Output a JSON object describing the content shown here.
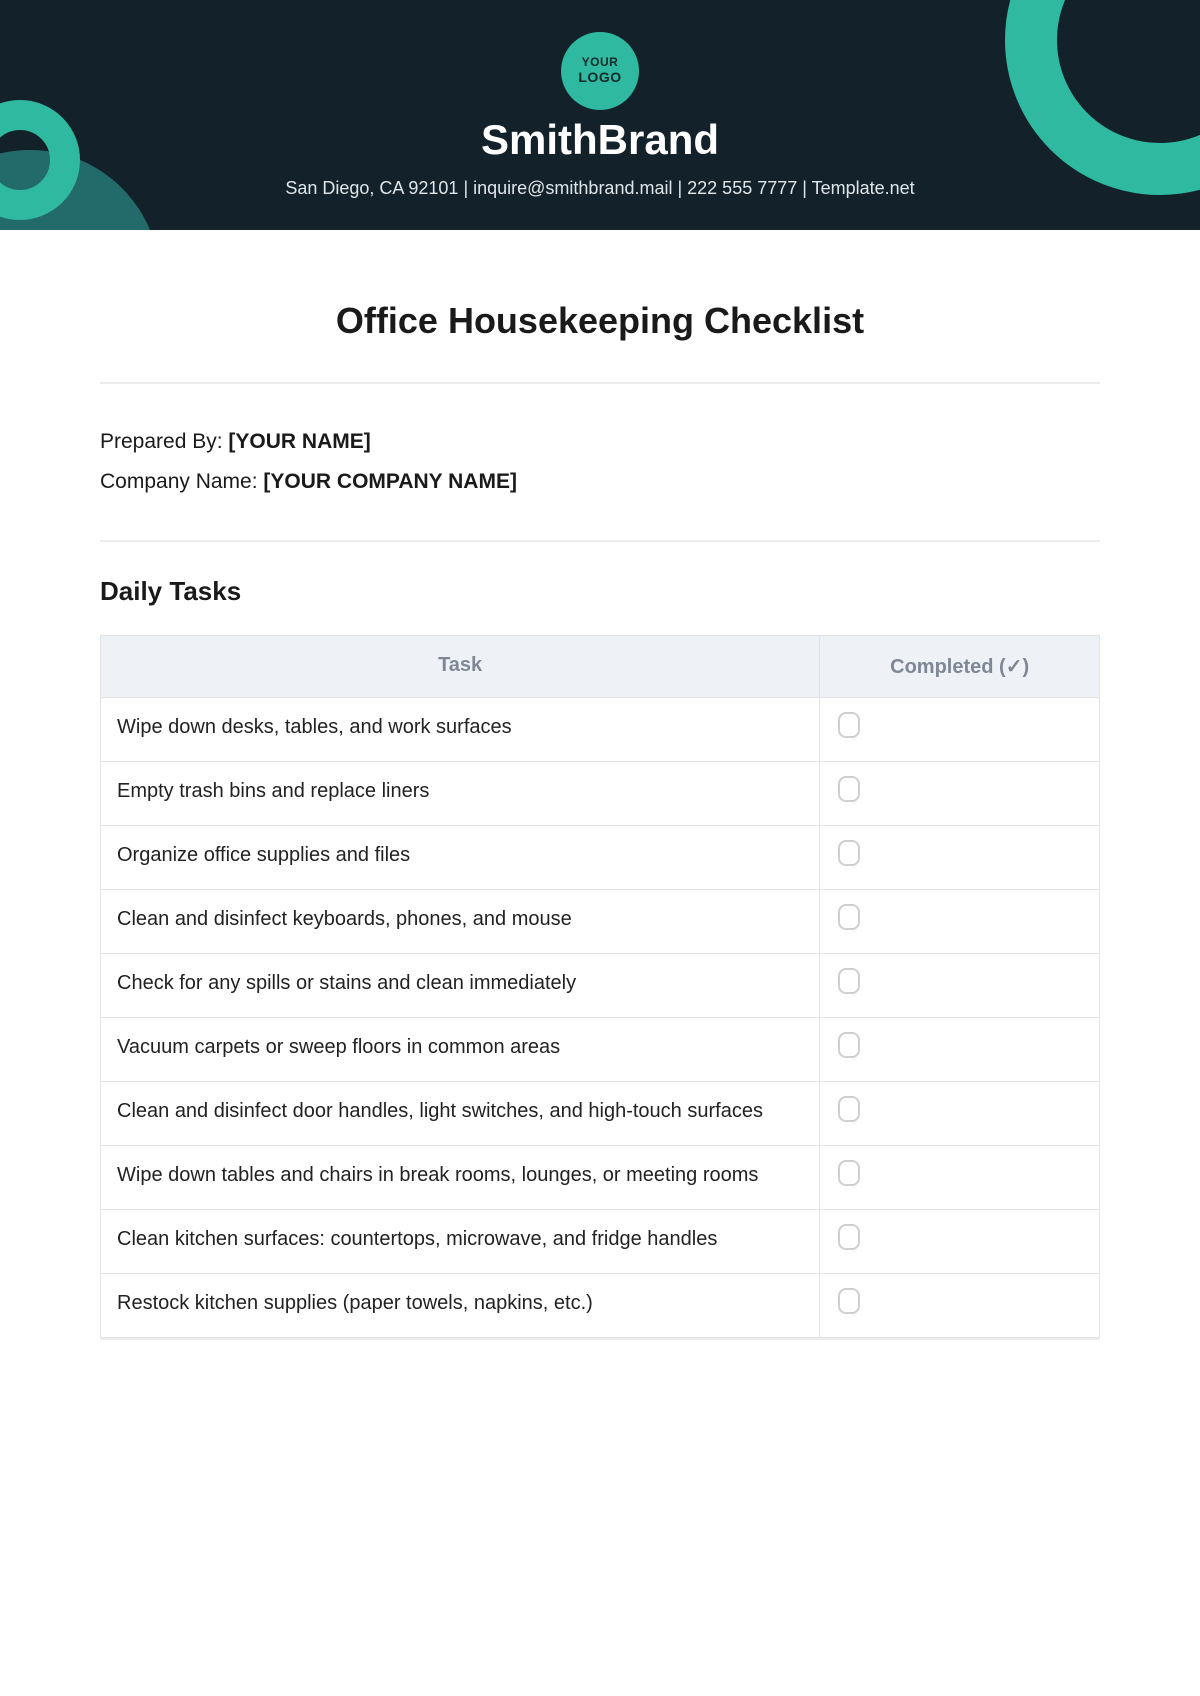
{
  "header": {
    "logo_line1": "YOUR",
    "logo_line2": "LOGO",
    "brand": "SmithBrand",
    "contact": "San Diego, CA 92101 | inquire@smithbrand.mail | 222 555 7777 | Template.net"
  },
  "document": {
    "title": "Office Housekeeping Checklist",
    "prepared_by_label": "Prepared By: ",
    "prepared_by_value": "[YOUR NAME]",
    "company_label": "Company Name: ",
    "company_value": "[YOUR COMPANY NAME]"
  },
  "sections": {
    "daily": {
      "heading": "Daily Tasks",
      "columns": {
        "task": "Task",
        "completed": "Completed (✓)"
      },
      "tasks": [
        "Wipe down desks, tables, and work surfaces",
        "Empty trash bins and replace liners",
        "Organize office supplies and files",
        "Clean and disinfect keyboards, phones, and mouse",
        "Check for any spills or stains and clean immediately",
        "Vacuum carpets or sweep floors in common areas",
        "Clean and disinfect door handles, light switches, and high-touch surfaces",
        "Wipe down tables and chairs in break rooms, lounges, or meeting rooms",
        "Clean kitchen surfaces: countertops, microwave, and fridge handles",
        "Restock kitchen supplies (paper towels, napkins, etc.)"
      ]
    }
  }
}
